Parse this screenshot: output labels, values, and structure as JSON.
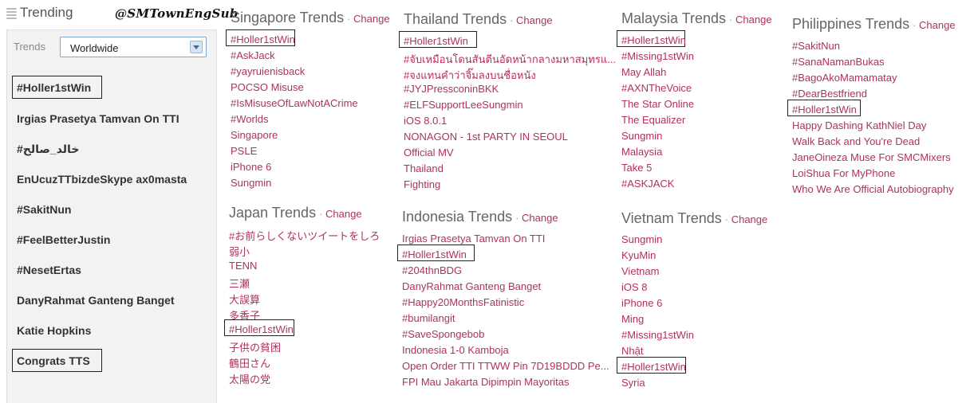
{
  "header": {
    "title": "Trending",
    "watermark": "@SMTownEngSub"
  },
  "sidebar": {
    "label": "Trends",
    "location": "Worldwide",
    "items": [
      {
        "label": "#Holler1stWin"
      },
      {
        "label": "Irgias Prasetya Tamvan On TTI"
      },
      {
        "label": "#خالد_صالح"
      },
      {
        "label": "EnUcuzTTbizdeSkype ax0masta"
      },
      {
        "label": "#SakitNun"
      },
      {
        "label": "#FeelBetterJustin"
      },
      {
        "label": "#NesetErtas"
      },
      {
        "label": "DanyRahmat Ganteng Banget"
      },
      {
        "label": "Katie Hopkins"
      },
      {
        "label": "Congrats TTS"
      }
    ]
  },
  "change_label": "Change",
  "regions": {
    "singapore": {
      "title": "Singapore Trends",
      "trends": [
        "#Holler1stWin",
        "#AskJack",
        "#yayruienisback",
        "POCSO Misuse",
        "#IsMisuseOfLawNotACrime",
        "#Worlds",
        "Singapore",
        "PSLE",
        "iPhone 6",
        "Sungmin"
      ]
    },
    "japan": {
      "title": "Japan Trends",
      "trends": [
        "#お前らしくないツイートをしろ",
        "弱小",
        "TENN",
        "三瀬",
        "大誤算",
        "多香子",
        "#Holler1stWin",
        "子供の貧困",
        "鶴田さん",
        "太陽の党"
      ]
    },
    "thailand": {
      "title": "Thailand Trends",
      "trends": [
        "#Holler1stWin",
        "#จับเหมือนโดนสันตีนอัดหน้ากลางมหาสมุทรแ...",
        "#จงแทนคำว่าจิ๊มลงบนชื่อหนัง",
        "#JYJPressconinBKK",
        "#ELFSupportLeeSungmin",
        "iOS 8.0.1",
        "NONAGON - 1st PARTY IN SEOUL",
        "Official MV",
        "Thailand",
        "Fighting"
      ]
    },
    "indonesia": {
      "title": "Indonesia Trends",
      "trends": [
        "Irgias Prasetya Tamvan On TTI",
        "#Holler1stWin",
        "#204thnBDG",
        "DanyRahmat Ganteng Banget",
        "#Happy20MonthsFatinistic",
        "#bumilangit",
        "#SaveSpongebob",
        "Indonesia 1-0 Kamboja",
        "Open Order TTI TTWW Pin 7D19BDDD Pe...",
        "FPI Mau Jakarta Dipimpin Mayoritas"
      ]
    },
    "malaysia": {
      "title": "Malaysia Trends",
      "trends": [
        "#Holler1stWin",
        "#Missing1stWin",
        "May Allah",
        "#AXNTheVoice",
        "The Star Online",
        "The Equalizer",
        "Sungmin",
        "Malaysia",
        "Take 5",
        "#ASKJACK"
      ]
    },
    "vietnam": {
      "title": "Vietnam Trends",
      "trends": [
        "Sungmin",
        "KyuMin",
        "Vietnam",
        "iOS 8",
        "iPhone 6",
        "Ming",
        "#Missing1stWin",
        "Nhật",
        "#Holler1stWin",
        "Syria"
      ]
    },
    "philippines": {
      "title": "Philippines Trends",
      "trends": [
        "#SakitNun",
        "#SanaNamanBukas",
        "#BagoAkoMamamatay",
        "#DearBestfriend",
        "#Holler1stWin",
        "Happy Dashing KathNiel Day",
        "Walk Back and You're Dead",
        "JaneOineza Muse For SMCMixers",
        "LoiShua For MyPhone",
        "Who We Are Official Autobiography"
      ]
    }
  },
  "colors": {
    "link": "#b03060",
    "heading": "#666666",
    "sidebar_bg": "#f2f2f2"
  }
}
